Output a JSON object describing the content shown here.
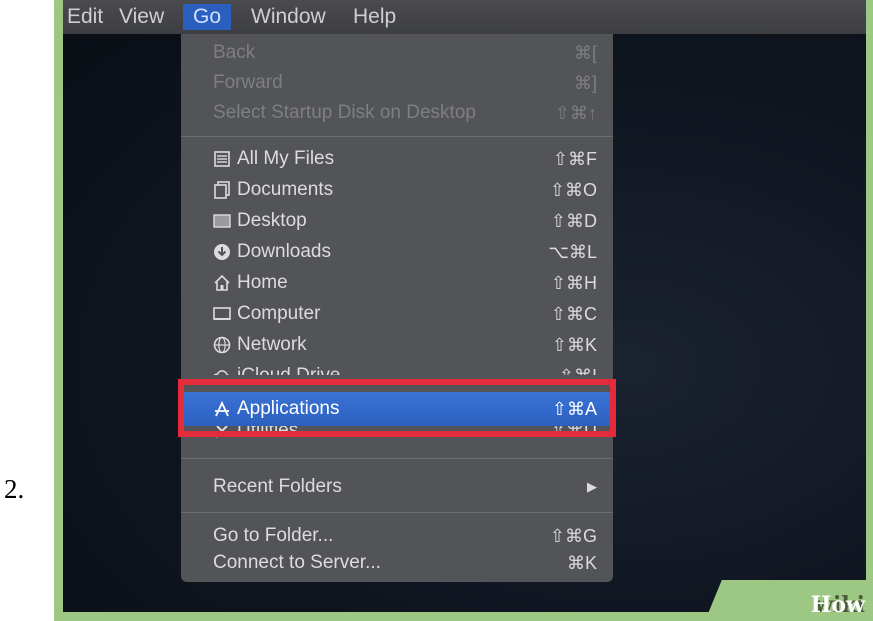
{
  "step_number": "2.",
  "menubar": {
    "items": [
      "Edit",
      "View",
      "Go",
      "Window",
      "Help"
    ],
    "active": "Go"
  },
  "menu": {
    "nav": [
      {
        "label": "Back",
        "shortcut": "⌘["
      },
      {
        "label": "Forward",
        "shortcut": "⌘]"
      },
      {
        "label": "Select Startup Disk on Desktop",
        "shortcut": "⇧⌘↑"
      }
    ],
    "places": [
      {
        "label": "All My Files",
        "shortcut": "⇧⌘F",
        "icon": "all-files-icon"
      },
      {
        "label": "Documents",
        "shortcut": "⇧⌘O",
        "icon": "documents-icon"
      },
      {
        "label": "Desktop",
        "shortcut": "⇧⌘D",
        "icon": "desktop-icon"
      },
      {
        "label": "Downloads",
        "shortcut": "⌥⌘L",
        "icon": "downloads-icon"
      },
      {
        "label": "Home",
        "shortcut": "⇧⌘H",
        "icon": "home-icon"
      },
      {
        "label": "Computer",
        "shortcut": "⇧⌘C",
        "icon": "computer-icon"
      },
      {
        "label": "Network",
        "shortcut": "⇧⌘K",
        "icon": "network-icon"
      },
      {
        "label": "iCloud Drive",
        "shortcut": "⇧⌘I",
        "icon": "cloud-icon"
      },
      {
        "label": "Applications",
        "shortcut": "⇧⌘A",
        "icon": "applications-icon",
        "selected": true
      },
      {
        "label": "Utilities",
        "shortcut": "⇧⌘U",
        "icon": "utilities-icon"
      }
    ],
    "recent_folders": "Recent Folders",
    "recent_arrow": "▶",
    "go_to_folder": {
      "label": "Go to Folder...",
      "shortcut": "⇧⌘G"
    },
    "connect": {
      "label": "Connect to Server...",
      "shortcut": "⌘K"
    }
  },
  "watermark": {
    "wiki": "wiki",
    "how": "How"
  },
  "colors": {
    "highlight": "#e32b3c",
    "selection": "#2c60c0",
    "frame": "#9dc883"
  }
}
